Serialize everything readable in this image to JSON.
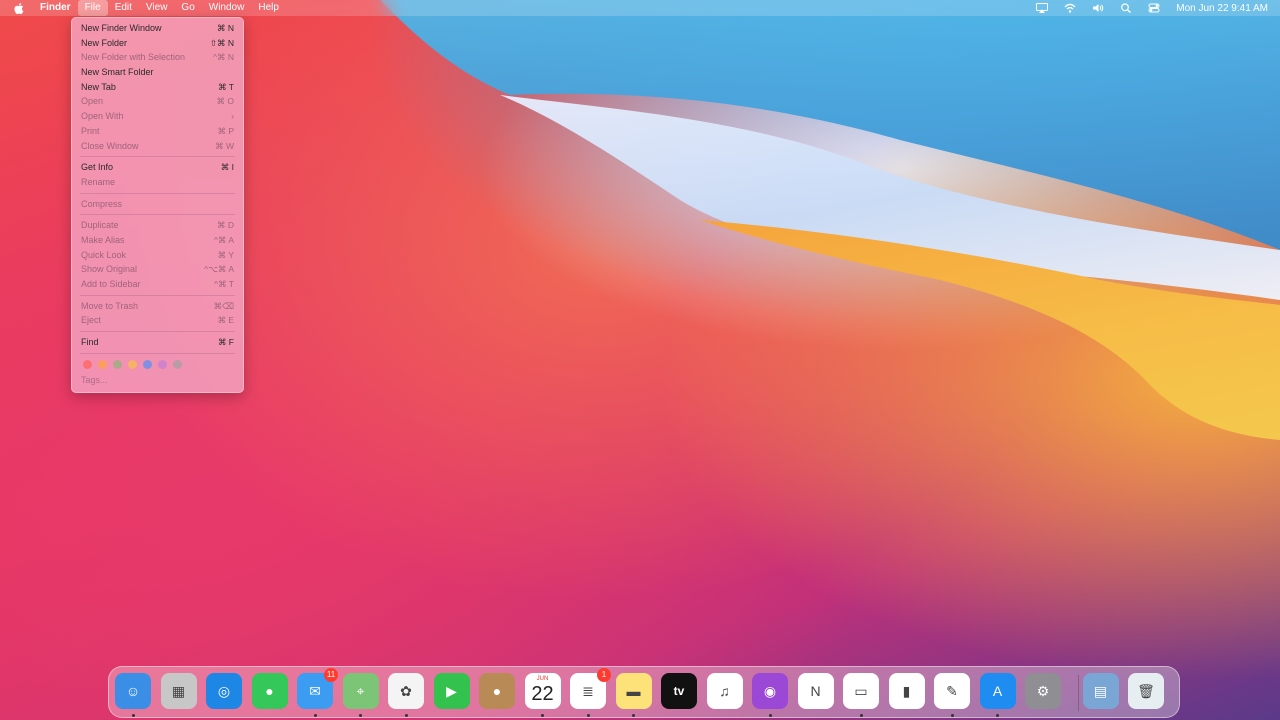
{
  "menubar": {
    "items": [
      "Finder",
      "File",
      "Edit",
      "View",
      "Go",
      "Window",
      "Help"
    ],
    "clock": "Mon Jun 22  9:41 AM",
    "status_icons": [
      "airplay-icon",
      "wifi-icon",
      "volume-icon",
      "search-icon",
      "control-center-icon"
    ]
  },
  "file_menu": {
    "items": [
      {
        "label": "New Finder Window",
        "shortcut": "⌘ N",
        "enabled": true
      },
      {
        "label": "New Folder",
        "shortcut": "⇧⌘ N",
        "enabled": true
      },
      {
        "label": "New Folder with Selection",
        "shortcut": "^⌘ N",
        "enabled": false
      },
      {
        "label": "New Smart Folder",
        "shortcut": "",
        "enabled": true
      },
      {
        "label": "New Tab",
        "shortcut": "⌘ T",
        "enabled": true
      },
      {
        "label": "Open",
        "shortcut": "⌘ O",
        "enabled": false
      },
      {
        "label": "Open With",
        "shortcut": "›",
        "enabled": false
      },
      {
        "label": "Print",
        "shortcut": "⌘ P",
        "enabled": false
      },
      {
        "label": "Close Window",
        "shortcut": "⌘ W",
        "enabled": false
      },
      {
        "sep": true
      },
      {
        "label": "Get Info",
        "shortcut": "⌘ I",
        "enabled": true
      },
      {
        "label": "Rename",
        "shortcut": "",
        "enabled": false
      },
      {
        "sep": true
      },
      {
        "label": "Compress",
        "shortcut": "",
        "enabled": false
      },
      {
        "sep": true
      },
      {
        "label": "Duplicate",
        "shortcut": "⌘ D",
        "enabled": false
      },
      {
        "label": "Make Alias",
        "shortcut": "^⌘ A",
        "enabled": false
      },
      {
        "label": "Quick Look",
        "shortcut": "⌘ Y",
        "enabled": false
      },
      {
        "label": "Show Original",
        "shortcut": "^⌥⌘ A",
        "enabled": false
      },
      {
        "label": "Add to Sidebar",
        "shortcut": "^⌘ T",
        "enabled": false
      },
      {
        "sep": true
      },
      {
        "label": "Move to Trash",
        "shortcut": "⌘⌫",
        "enabled": false
      },
      {
        "label": "Eject",
        "shortcut": "⌘ E",
        "enabled": false
      },
      {
        "sep": true
      },
      {
        "label": "Find",
        "shortcut": "⌘ F",
        "enabled": true
      },
      {
        "sep": true
      }
    ],
    "tag_colors": [
      "#ff5f57",
      "#ffa33a",
      "#8fb37a",
      "#f6c044",
      "#4f8ef7",
      "#c27bd9",
      "#a0a0a0"
    ],
    "tags_label": "Tags..."
  },
  "dock": {
    "apps": [
      {
        "name": "finder",
        "color": "#3a8ee6",
        "glyph": "☺"
      },
      {
        "name": "launchpad",
        "color": "#c7c7c7",
        "glyph": "▦"
      },
      {
        "name": "safari",
        "color": "#1e86e5",
        "glyph": "◎"
      },
      {
        "name": "messages",
        "color": "#34c759",
        "glyph": "●"
      },
      {
        "name": "mail",
        "color": "#3b9cf2",
        "glyph": "✉",
        "badge": "11"
      },
      {
        "name": "maps",
        "color": "#7cc576",
        "glyph": "⌖"
      },
      {
        "name": "photos",
        "color": "#f4f4f4",
        "glyph": "✿"
      },
      {
        "name": "facetime",
        "color": "#32c24d",
        "glyph": "▶"
      },
      {
        "name": "contacts",
        "color": "#b88a55",
        "glyph": "●"
      },
      {
        "name": "calendar",
        "color": "#ffffff",
        "glyph": "",
        "month": "JUN",
        "day": "22"
      },
      {
        "name": "reminders",
        "color": "#ffffff",
        "glyph": "≣",
        "badge": "1"
      },
      {
        "name": "notes",
        "color": "#fde27a",
        "glyph": "▬"
      },
      {
        "name": "tv",
        "color": "#111111",
        "glyph": "tv"
      },
      {
        "name": "music",
        "color": "#ffffff",
        "glyph": "♫"
      },
      {
        "name": "podcasts",
        "color": "#9b48d6",
        "glyph": "◉"
      },
      {
        "name": "news",
        "color": "#ffffff",
        "glyph": "N"
      },
      {
        "name": "keynote",
        "color": "#ffffff",
        "glyph": "▭"
      },
      {
        "name": "numbers",
        "color": "#ffffff",
        "glyph": "▮"
      },
      {
        "name": "pages",
        "color": "#ffffff",
        "glyph": "✎"
      },
      {
        "name": "app-store",
        "color": "#1f8cf2",
        "glyph": "A"
      },
      {
        "name": "system-preferences",
        "color": "#8e8e93",
        "glyph": "⚙"
      },
      {
        "name": "downloads-stack",
        "color": "#7aa6d6",
        "glyph": "▤"
      },
      {
        "name": "trash",
        "color": "#e6eef2",
        "glyph": "🗑"
      }
    ],
    "running_indicators": [
      0,
      4,
      5,
      6,
      9,
      10,
      11,
      14,
      16,
      18,
      19
    ]
  }
}
